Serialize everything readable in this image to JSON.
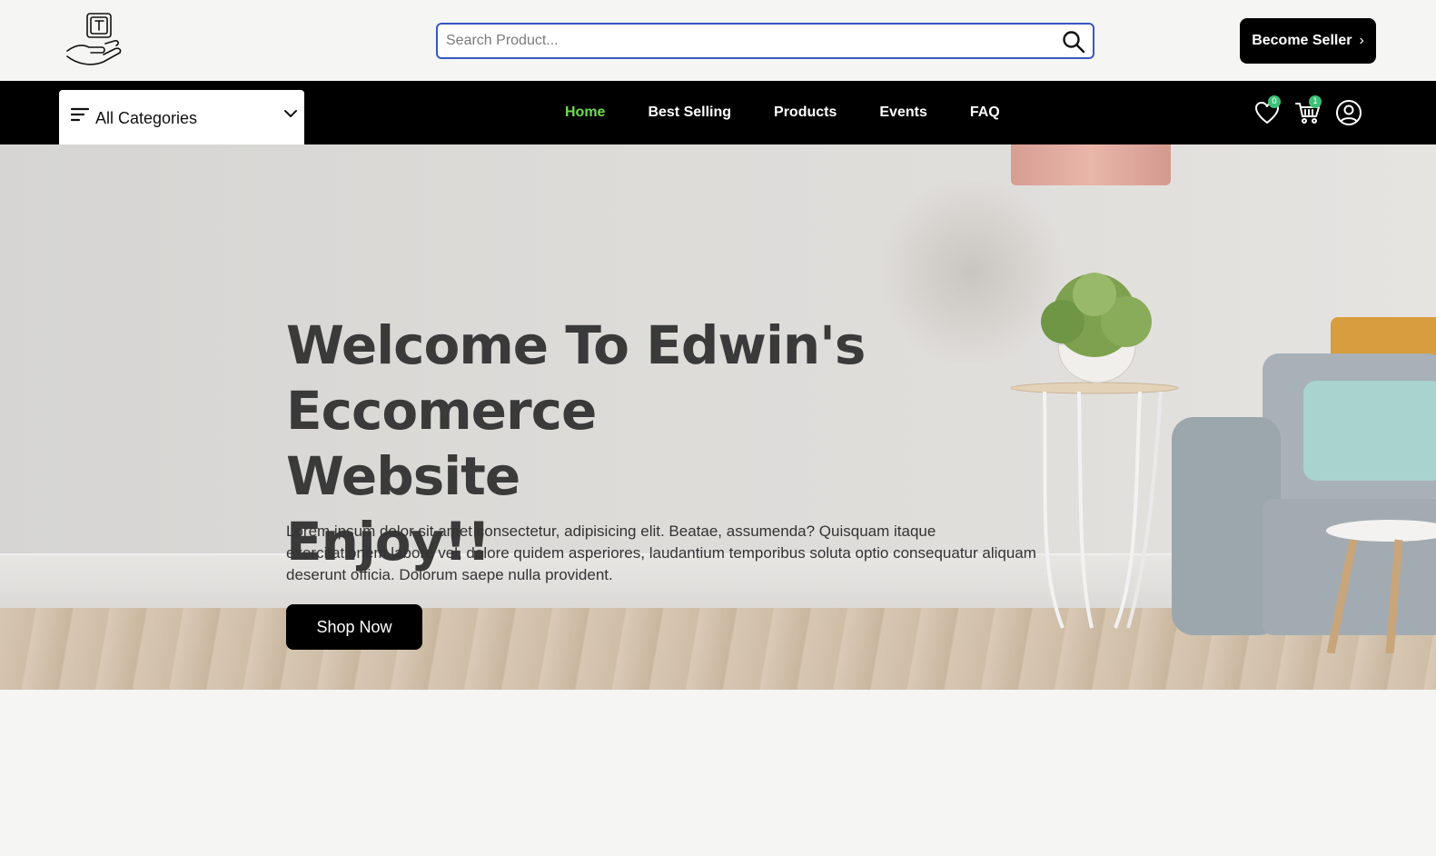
{
  "header": {
    "logo_icon": "hand-holding-box-icon",
    "search": {
      "placeholder": "Search Product...",
      "value": "",
      "icon": "search-icon"
    },
    "become_seller": {
      "label": "Become Seller",
      "chevron": "›"
    }
  },
  "nav": {
    "categories_label": "All Categories",
    "links": [
      {
        "label": "Home",
        "active": true
      },
      {
        "label": "Best Selling"
      },
      {
        "label": "Products"
      },
      {
        "label": "Events"
      },
      {
        "label": "FAQ"
      }
    ],
    "wishlist_count": "0",
    "cart_count": "1",
    "active_color": "#6fdc4d",
    "badge_color": "#3bc177"
  },
  "hero": {
    "title_line1": "Welcome To Edwin's Eccomerce",
    "title_line2": "Website",
    "title_line3": "Enjoy!!",
    "description": "Lorem ipsum dolor sit amet consectetur, adipisicing elit. Beatae, assumenda? Quisquam itaque exercitationem labore vel, dolore quidem asperiores, laudantium temporibus soluta optio consequatur aliquam deserunt officia. Dolorum saepe nulla provident.",
    "cta_label": "Shop Now"
  }
}
